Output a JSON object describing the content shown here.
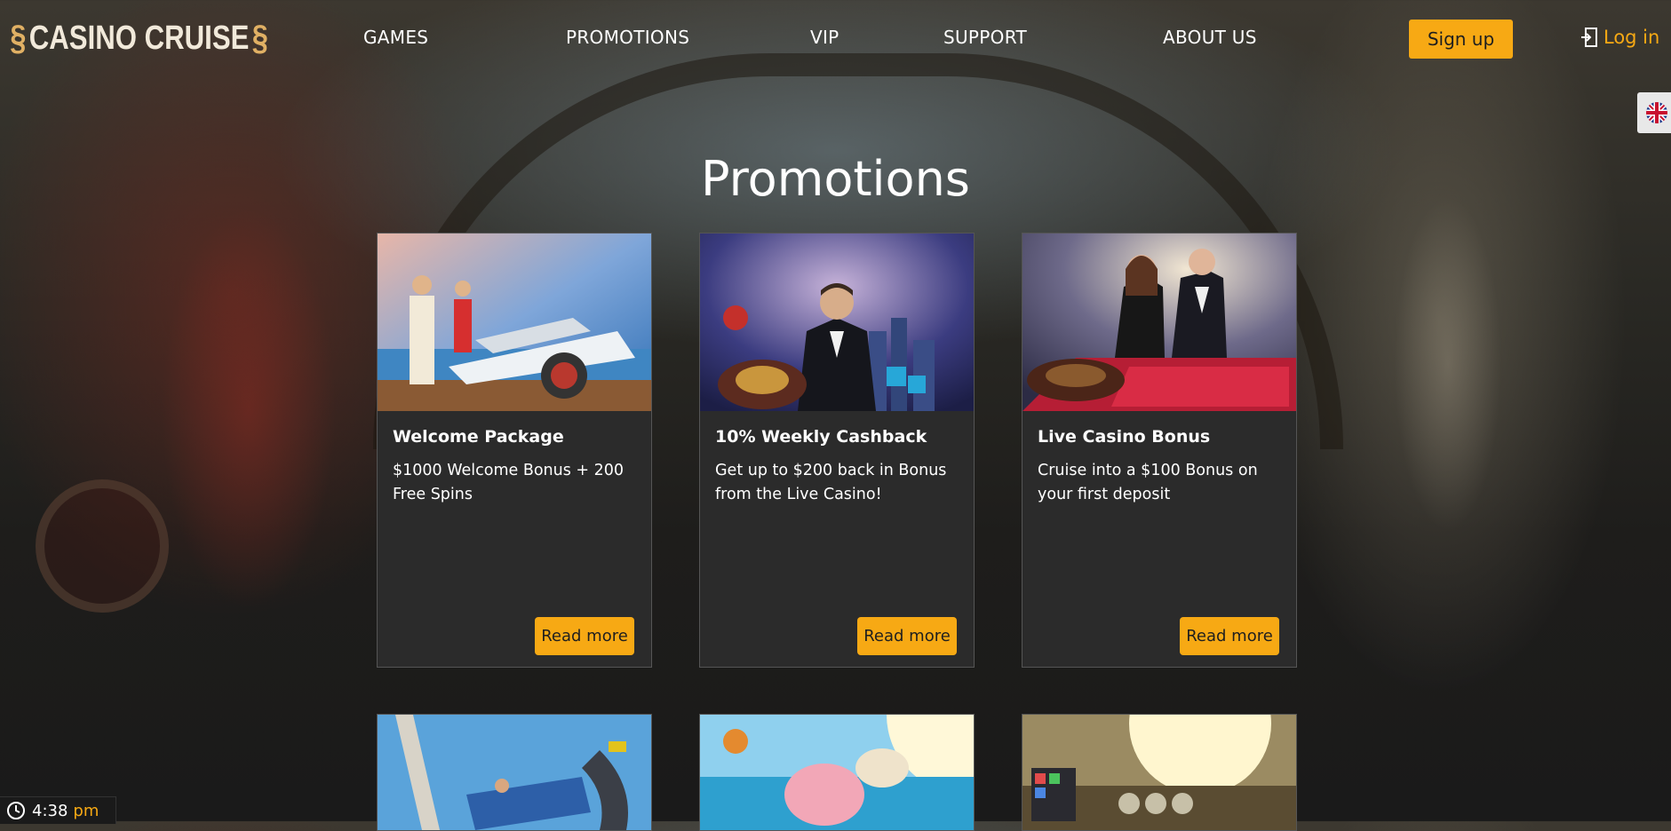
{
  "brand": {
    "logo_text": "CASINO CRUISE"
  },
  "nav": {
    "items": [
      {
        "label": "GAMES"
      },
      {
        "label": "PROMOTIONS"
      },
      {
        "label": "VIP"
      },
      {
        "label": "SUPPORT"
      },
      {
        "label": "ABOUT US"
      }
    ]
  },
  "auth": {
    "signup_label": "Sign up",
    "login_label": "Log in"
  },
  "language": {
    "current": "uk-flag-icon"
  },
  "page": {
    "title": "Promotions"
  },
  "promotions": [
    {
      "title": "Welcome Package",
      "description": "$1000 Welcome Bonus + 200 Free Spins",
      "button_label": "Read more"
    },
    {
      "title": "10% Weekly Cashback",
      "description": "Get up to $200 back in Bonus from the Live Casino!",
      "button_label": "Read more"
    },
    {
      "title": "Live Casino Bonus",
      "description": "Cruise into a $100 Bonus on your first deposit",
      "button_label": "Read more"
    }
  ],
  "clock": {
    "time": "4:38",
    "ampm": "pm"
  },
  "colors": {
    "accent": "#f7a914",
    "card_bg": "#2b2b2b",
    "page_bg": "#1e1d1b"
  }
}
